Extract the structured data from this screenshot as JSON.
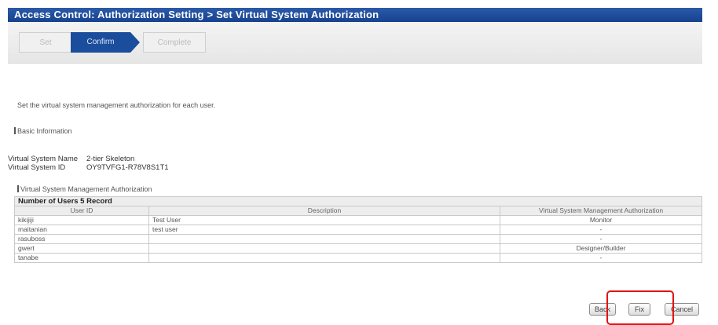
{
  "header": {
    "title": "Access Control: Authorization Setting > Set Virtual System Authorization"
  },
  "steps": [
    {
      "label": "Set",
      "state": "inactive"
    },
    {
      "label": "Confirm",
      "state": "active"
    },
    {
      "label": "Complete",
      "state": "inactive"
    }
  ],
  "intro": "Set the virtual system management authorization for each user.",
  "basic": {
    "heading": "Basic Information",
    "name_label": "Virtual System Name",
    "name_value": "2-tier Skeleton",
    "id_label": "Virtual System ID",
    "id_value": "OY9TVFG1-R78V8S1T1"
  },
  "authz": {
    "heading": "Virtual System Management Authorization",
    "count_text": "Number of Users 5 Record",
    "columns": [
      "User ID",
      "Description",
      "Virtual System Management Authorization"
    ],
    "rows": [
      [
        "kikijiji",
        "Test User",
        "Monitor"
      ],
      [
        "maitanian",
        "test user",
        "-"
      ],
      [
        "rasuboss",
        "",
        "-"
      ],
      [
        "gwert",
        "",
        "Designer/Builder"
      ],
      [
        "tanabe",
        "",
        "-"
      ]
    ]
  },
  "buttons": {
    "back": "Back",
    "fix": "Fix",
    "cancel": "Cancel"
  },
  "colors": {
    "titlebar": "#174290",
    "active_step": "#1a4d9c",
    "highlight": "#e01414"
  }
}
